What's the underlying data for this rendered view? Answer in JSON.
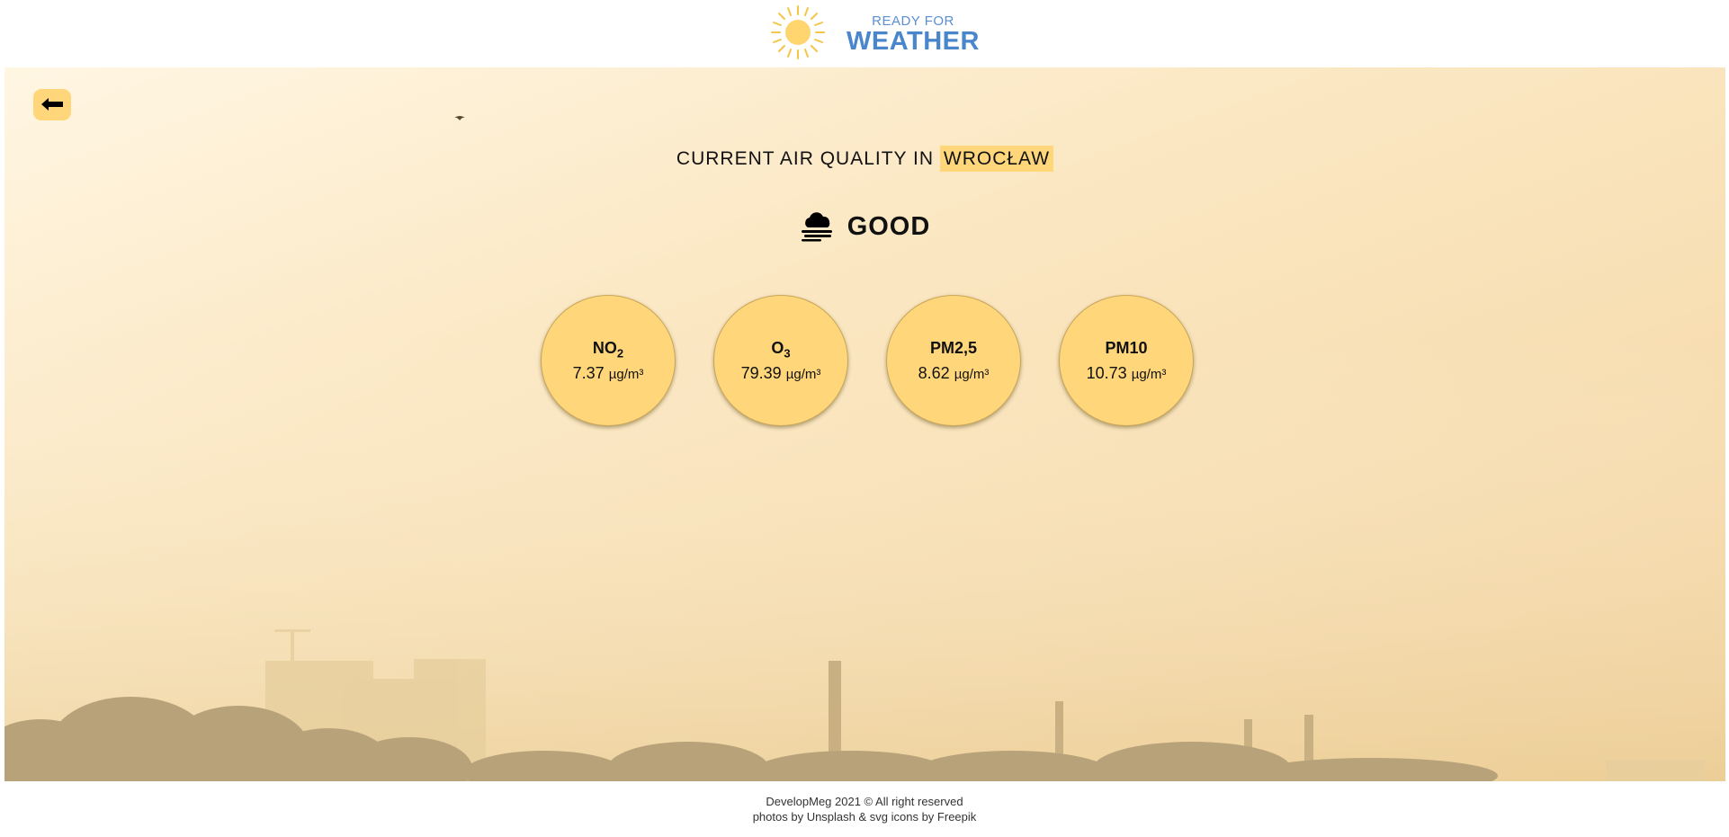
{
  "header": {
    "logo_top": "READY FOR",
    "logo_bottom": "WEATHER"
  },
  "back_button": {
    "icon": "arrow-left-icon"
  },
  "title": {
    "prefix": "CURRENT AIR QUALITY IN",
    "city": "WROCŁAW"
  },
  "status": {
    "icon": "cloud-fog-icon",
    "label": "GOOD"
  },
  "pollutants": [
    {
      "name": "NO",
      "sub": "2",
      "value": "7.37",
      "unit": "µg/m³"
    },
    {
      "name": "O",
      "sub": "3",
      "value": "79.39",
      "unit": "µg/m³"
    },
    {
      "name": "PM2,5",
      "sub": "",
      "value": "8.62",
      "unit": "µg/m³"
    },
    {
      "name": "PM10",
      "sub": "",
      "value": "10.73",
      "unit": "µg/m³"
    }
  ],
  "footer": {
    "line1": "DevelopMeg 2021 © All right reserved",
    "line2": "photos by Unsplash & svg icons by Freepik"
  },
  "colors": {
    "accent": "#ffd77a",
    "logo_blue": "#4a86cc"
  }
}
